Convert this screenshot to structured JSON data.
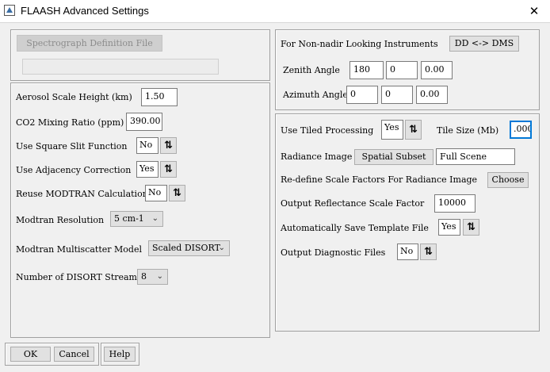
{
  "window": {
    "title": "FLAASH Advanced Settings",
    "close_glyph": "✕"
  },
  "left_top": {
    "spectrograph_button": "Spectrograph Definition File",
    "spectrograph_path": ""
  },
  "left_main": {
    "aerosol_label": "Aerosol Scale Height (km)",
    "aerosol_value": "1.50",
    "co2_label": "CO2 Mixing Ratio (ppm)",
    "co2_value": "390.00",
    "square_slit_label": "Use Square Slit Function",
    "square_slit_value": "No",
    "adjacency_label": "Use Adjacency Correction",
    "adjacency_value": "Yes",
    "reuse_label": "Reuse MODTRAN Calculations",
    "reuse_value": "No",
    "resolution_label": "Modtran Resolution",
    "resolution_value": "5 cm-1",
    "multiscatter_label": "Modtran Multiscatter Model",
    "multiscatter_value": "Scaled DISORT",
    "disort_label": "Number of DISORT Streams",
    "disort_value": "8",
    "toggle_icon": "⇅",
    "chevron_icon": "⌄"
  },
  "right_top": {
    "nonnadir_label": "For Non-nadir Looking Instruments",
    "dd_dms_button": "DD <-> DMS",
    "zenith_label": "Zenith Angle",
    "zenith_deg": "180",
    "zenith_min": "0",
    "zenith_sec": "0.00",
    "azimuth_label": "Azimuth Angle",
    "azimuth_deg": "0",
    "azimuth_min": "0",
    "azimuth_sec": "0.00"
  },
  "right_main": {
    "tiled_label": "Use Tiled Processing",
    "tiled_value": "Yes",
    "tile_size_label": "Tile Size (Mb)",
    "tile_size_value": ".000",
    "radiance_label": "Radiance Image",
    "spatial_subset_button": "Spatial Subset",
    "full_scene_value": "Full Scene",
    "redefine_label": "Re-define Scale Factors For Radiance Image",
    "choose_button": "Choose",
    "output_scale_label": "Output Reflectance Scale Factor",
    "output_scale_value": "10000",
    "auto_save_label": "Automatically Save Template File",
    "auto_save_value": "Yes",
    "diagnostic_label": "Output Diagnostic Files",
    "diagnostic_value": "No"
  },
  "footer": {
    "ok_button": "OK",
    "cancel_button": "Cancel",
    "help_button": "Help"
  }
}
